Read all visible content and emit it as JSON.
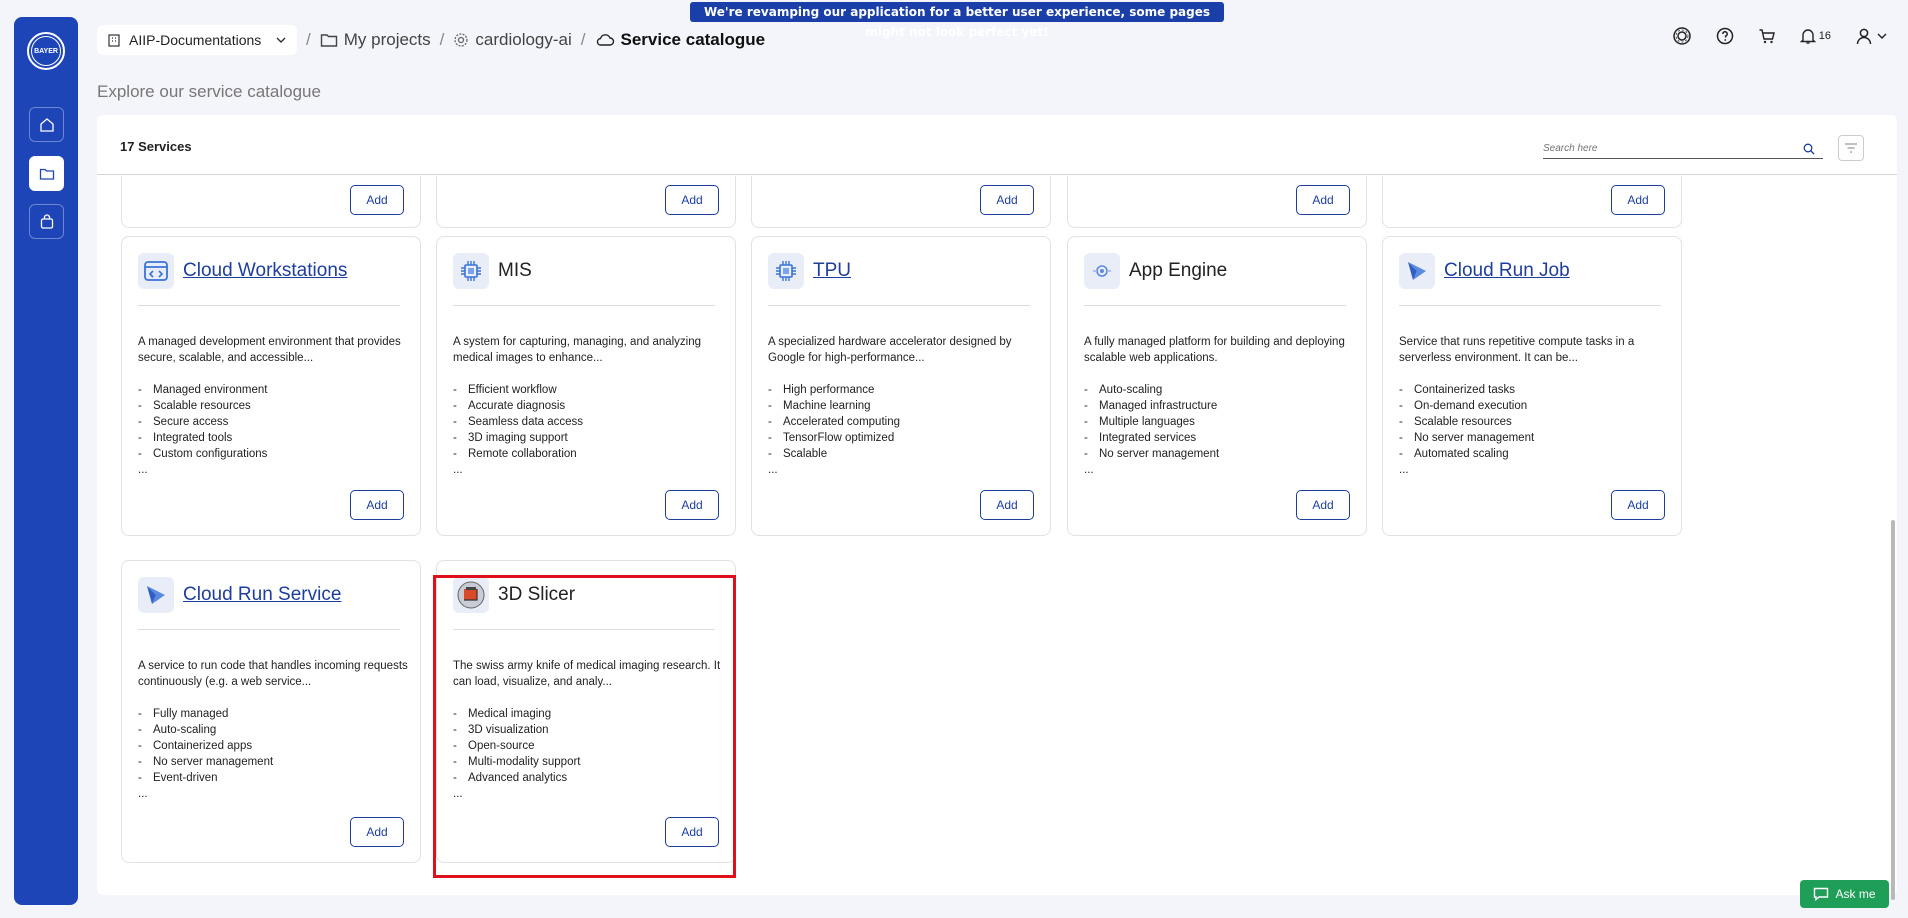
{
  "banner": {
    "text": "We're revamping our application for a better user experience, some pages might not look perfect yet!"
  },
  "sidebar": {
    "logo_text": "BAYER",
    "items": [
      {
        "name": "home"
      },
      {
        "name": "projects"
      },
      {
        "name": "catalogue"
      }
    ]
  },
  "header": {
    "org": "AIIP-Documentations",
    "breadcrumb": {
      "projects": "My projects",
      "project": "cardiology-ai",
      "current": "Service catalogue",
      "separator": "/"
    },
    "notifications_count": "16"
  },
  "page": {
    "title": "Explore our service catalogue"
  },
  "catalogue": {
    "count_label": "17 Services",
    "search_placeholder": "Search here",
    "add_label": "Add",
    "ellipsis": "...",
    "cards": [
      {
        "title": "Cloud Workstations",
        "link": true,
        "icon": "code-window-icon",
        "desc": "A managed development environment that provides secure, scalable, and accessible...",
        "features": [
          "Managed environment",
          "Scalable resources",
          "Secure access",
          "Integrated tools",
          "Custom configurations"
        ]
      },
      {
        "title": "MIS",
        "link": false,
        "icon": "chip-icon",
        "desc": "A system for capturing, managing, and analyzing medical images to enhance...",
        "features": [
          "Efficient workflow",
          "Accurate diagnosis",
          "Seamless data access",
          "3D imaging support",
          "Remote collaboration"
        ]
      },
      {
        "title": "TPU",
        "link": true,
        "icon": "chip-icon",
        "desc": "A specialized hardware accelerator designed by Google for high-performance...",
        "features": [
          "High performance",
          "Machine learning",
          "Accelerated computing",
          "TensorFlow optimized",
          "Scalable"
        ]
      },
      {
        "title": "App Engine",
        "link": false,
        "icon": "app-engine-icon",
        "desc": "A fully managed platform for building and deploying scalable web applications.",
        "features": [
          "Auto-scaling",
          "Managed infrastructure",
          "Multiple languages",
          "Integrated services",
          "No server management"
        ]
      },
      {
        "title": "Cloud Run Job",
        "link": true,
        "icon": "cloud-run-icon",
        "desc": "Service that runs repetitive compute tasks in a serverless environment. It can be...",
        "features": [
          "Containerized tasks",
          "On-demand execution",
          "Scalable resources",
          "No server management",
          "Automated scaling"
        ]
      },
      {
        "title": "Cloud Run Service",
        "link": true,
        "icon": "cloud-run-icon",
        "desc": "A service to run code that handles incoming requests continuously (e.g. a web service...",
        "features": [
          "Fully managed",
          "Auto-scaling",
          "Containerized apps",
          "No server management",
          "Event-driven"
        ]
      },
      {
        "title": "3D Slicer",
        "link": false,
        "icon": "slicer-logo-icon",
        "desc": "The swiss army knife of medical imaging research. It can load, visualize, and analy...",
        "features": [
          "Medical imaging",
          "3D visualization",
          "Open-source",
          "Multi-modality support",
          "Advanced analytics"
        ]
      }
    ]
  },
  "assistant": {
    "label": "Ask me"
  },
  "colors": {
    "sidebar": "#1e45b8",
    "accent": "#1e3e9e",
    "highlight": "#e0101b",
    "askme": "#1f9e57"
  }
}
